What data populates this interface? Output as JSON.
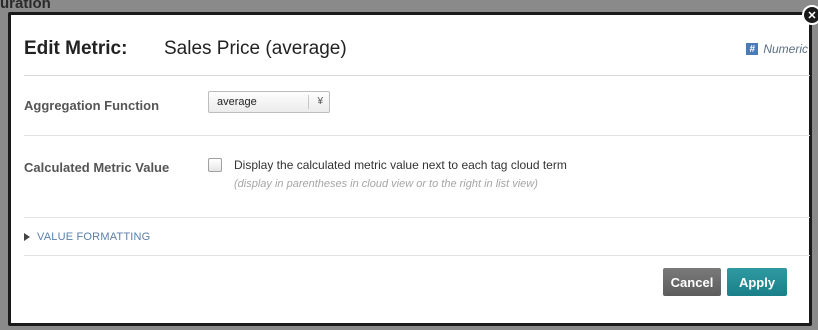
{
  "background": {
    "partial_title": "uration"
  },
  "dialog": {
    "close_icon": "close-icon",
    "title_prefix": "Edit Metric:",
    "title_name": "Sales Price (average)",
    "type_badge": {
      "icon": "hash-icon",
      "glyph": "#",
      "label": "Numeric",
      "color": "#4a7bb5"
    },
    "aggregation": {
      "label": "Aggregation Function",
      "selected_value": "average",
      "arrow_glyph": "¥"
    },
    "calculated": {
      "label": "Calculated Metric Value",
      "checked": false,
      "checkbox_text": "Display the calculated metric value next to each tag cloud term",
      "hint": "(display in parentheses in cloud view or to the right in list view)"
    },
    "formatting": {
      "label": "VALUE FORMATTING",
      "expanded": false
    },
    "buttons": {
      "cancel_label": "Cancel",
      "apply_label": "Apply",
      "cancel_color": "#666666",
      "apply_color": "#1f8a93"
    }
  }
}
